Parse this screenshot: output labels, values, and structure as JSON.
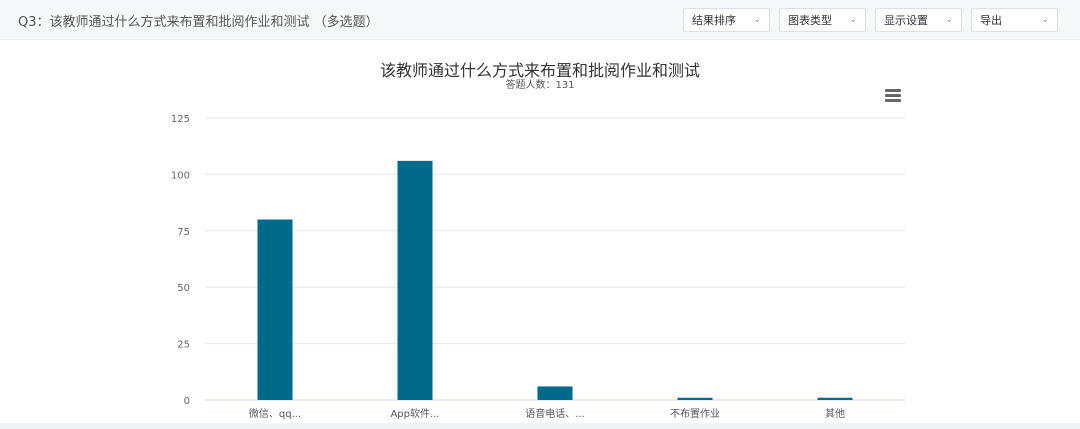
{
  "header": {
    "question": "Q3：该教师通过什么方式来布置和批阅作业和测试 （多选题）"
  },
  "toolbar": [
    {
      "label": "结果排序"
    },
    {
      "label": "图表类型"
    },
    {
      "label": "显示设置"
    },
    {
      "label": "导出"
    }
  ],
  "colors": {
    "bar": "#006a8a",
    "grid": "#e6e6e6",
    "axis": "#ccd6eb"
  },
  "icons": {
    "menu": "hamburger-menu-icon",
    "dropdown": "chevron-down-icon"
  },
  "chart_data": {
    "type": "bar",
    "title": "该教师通过什么方式来布置和批阅作业和测试",
    "subtitle": "答题人数：131",
    "categories": [
      "微信、qq...",
      "App软件...",
      "语音电话、...",
      "不布置作业",
      "其他"
    ],
    "values": [
      80,
      106,
      6,
      1,
      1
    ],
    "xlabel": "",
    "ylabel": "",
    "ylim": [
      0,
      125
    ],
    "yticks": [
      0,
      25,
      50,
      75,
      100,
      125
    ],
    "grid": true,
    "legend": "none"
  }
}
